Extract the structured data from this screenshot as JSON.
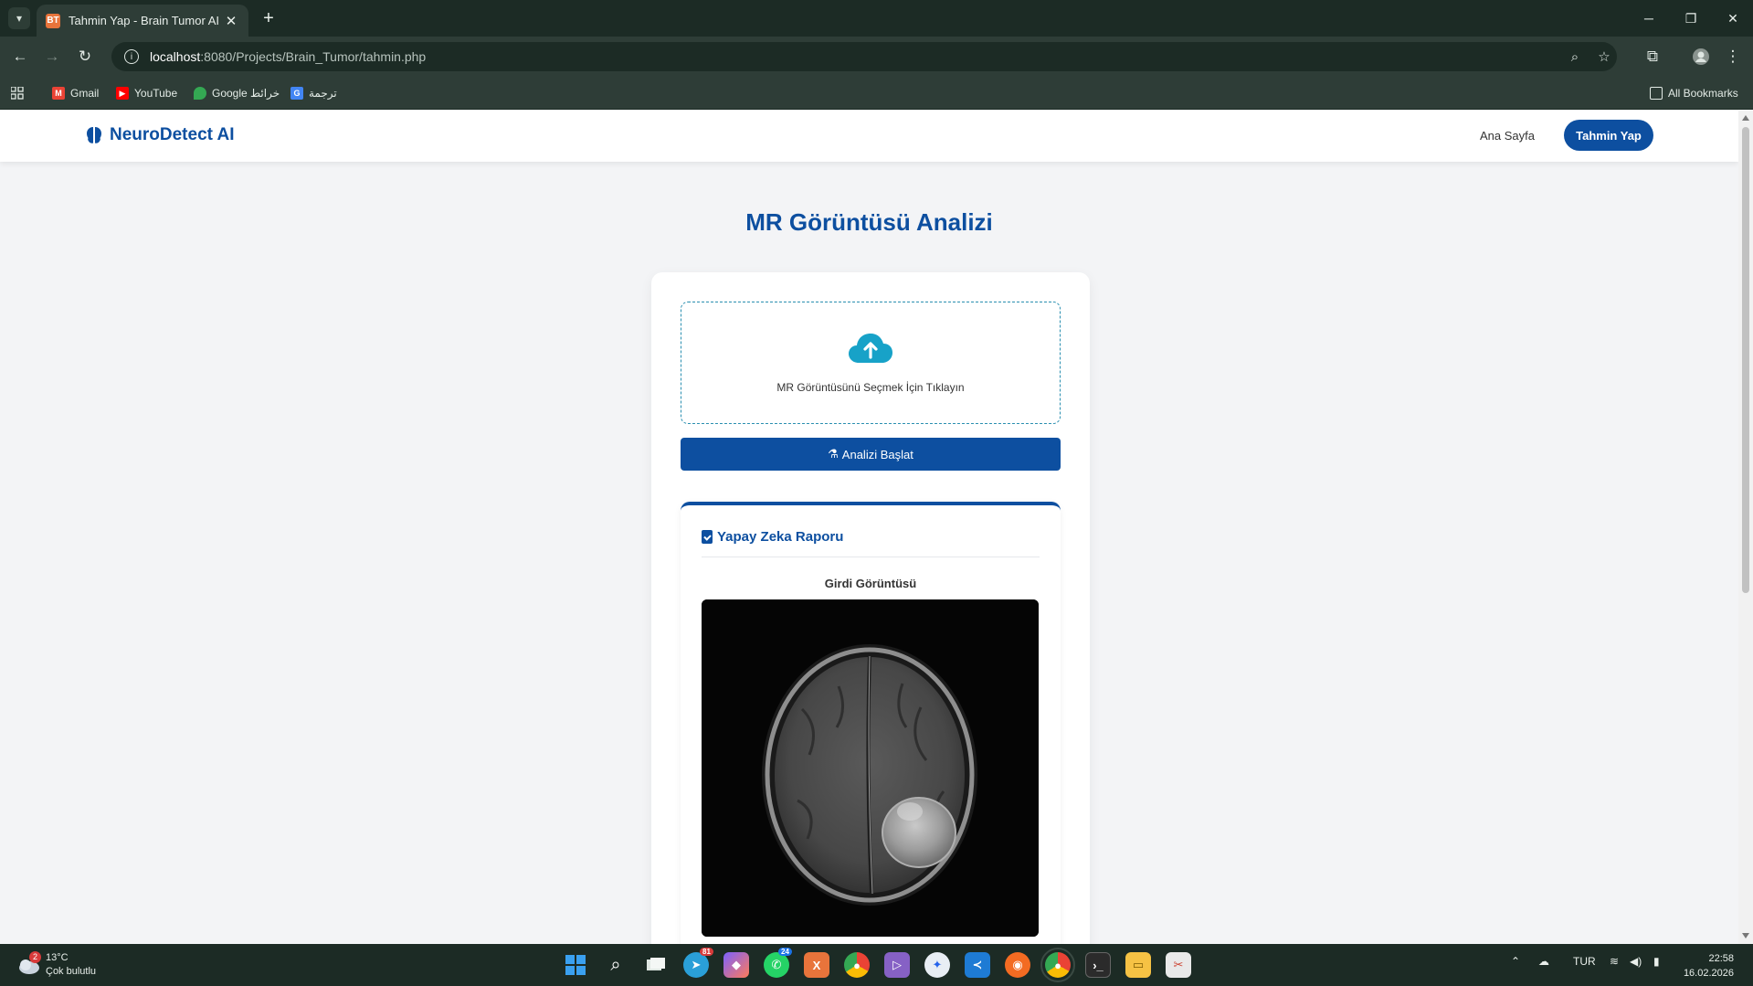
{
  "browser": {
    "tab_title": "Tahmin Yap - Brain Tumor AI",
    "tab_favicon": "BT",
    "url_host": "localhost",
    "url_path": ":8080/Projects/Brain_Tumor/tahmin.php",
    "bookmarks": [
      {
        "label": "Gmail",
        "icon": "gmail-icon",
        "color": "#ea4335"
      },
      {
        "label": "YouTube",
        "icon": "youtube-icon",
        "color": "#ff0000"
      },
      {
        "label": "Google خرائط",
        "icon": "maps-icon",
        "color": "#34a853"
      },
      {
        "label": "ترجمة",
        "icon": "translate-icon",
        "color": "#4285f4"
      }
    ],
    "all_bookmarks": "All Bookmarks"
  },
  "site": {
    "brand": "NeuroDetect AI",
    "nav_home": "Ana Sayfa",
    "nav_predict": "Tahmin Yap",
    "accent": "#0d4fa0"
  },
  "main": {
    "title": "MR Görüntüsü Analizi",
    "dropzone_text": "MR Görüntüsünü Seçmek İçin Tıklayın",
    "start_button": "Analizi Başlat",
    "report_title": "Yapay Zeka Raporu",
    "input_image_label": "Girdi Görüntüsü"
  },
  "taskbar": {
    "temperature": "13°C",
    "weather": "Çok bulutlu",
    "weather_badge": "2",
    "language": "TUR",
    "time": "22:58",
    "date": "16.02.2026",
    "badge_telegram": "81",
    "badge_whatsapp": "24"
  }
}
